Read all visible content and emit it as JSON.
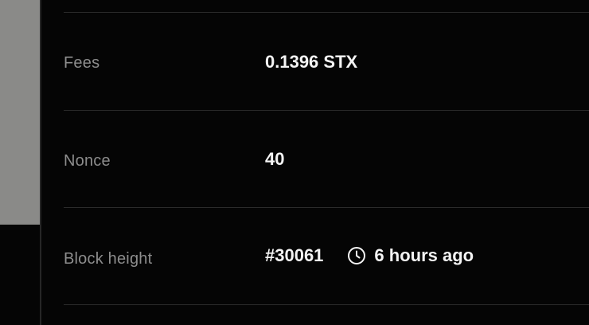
{
  "rows": [
    {
      "label": "Fees",
      "value": "0.1396 STX"
    },
    {
      "label": "Nonce",
      "value": "40"
    },
    {
      "label": "Block height",
      "value": "#30061",
      "time": "6 hours ago",
      "time_icon": "clock-icon"
    }
  ],
  "colors": {
    "background": "#050505",
    "label": "#8d8d8d",
    "value": "#f4f4f4",
    "divider": "#2b2b2b",
    "side_panel": "#8a8a88"
  }
}
